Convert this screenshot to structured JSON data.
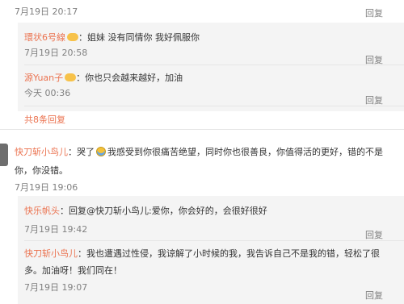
{
  "top_comment": {
    "time": "7月19日 20:17",
    "reply_label": "回复"
  },
  "replies_1": [
    {
      "user": "環状6号線",
      "text": "姐妹 没有同情你 我好佩服你",
      "time": "7月19日 20:58",
      "reply_label": "回复"
    },
    {
      "user": "源Yuan子",
      "text": "你也只会越来越好，加油",
      "time": "今天 00:36",
      "reply_label": "回复"
    }
  ],
  "more_replies": "共8条回复",
  "comment_2": {
    "user": "快刀斩小鸟儿",
    "text_prefix": "哭了",
    "text_line1": "我感受到你很痛苦绝望，同时你也很善良，你值得活的更好，错的不是",
    "text_line2": "你，你没错。",
    "time": "7月19日 19:06"
  },
  "replies_2": [
    {
      "user": "快乐帆头",
      "text": "回复@快刀斩小鸟儿:爱你，你会好的，会很好很好",
      "time": "7月19日 19:42",
      "reply_label": "回复"
    },
    {
      "user": "快刀斩小鸟儿",
      "text_line1": "我也遭遇过性侵，我谅解了小时候的我，我告诉自己不是我的错，轻松了很",
      "text_line2": "多。加油呀！我们同在！",
      "time": "7月19日 19:07",
      "reply_label": "回复"
    }
  ]
}
